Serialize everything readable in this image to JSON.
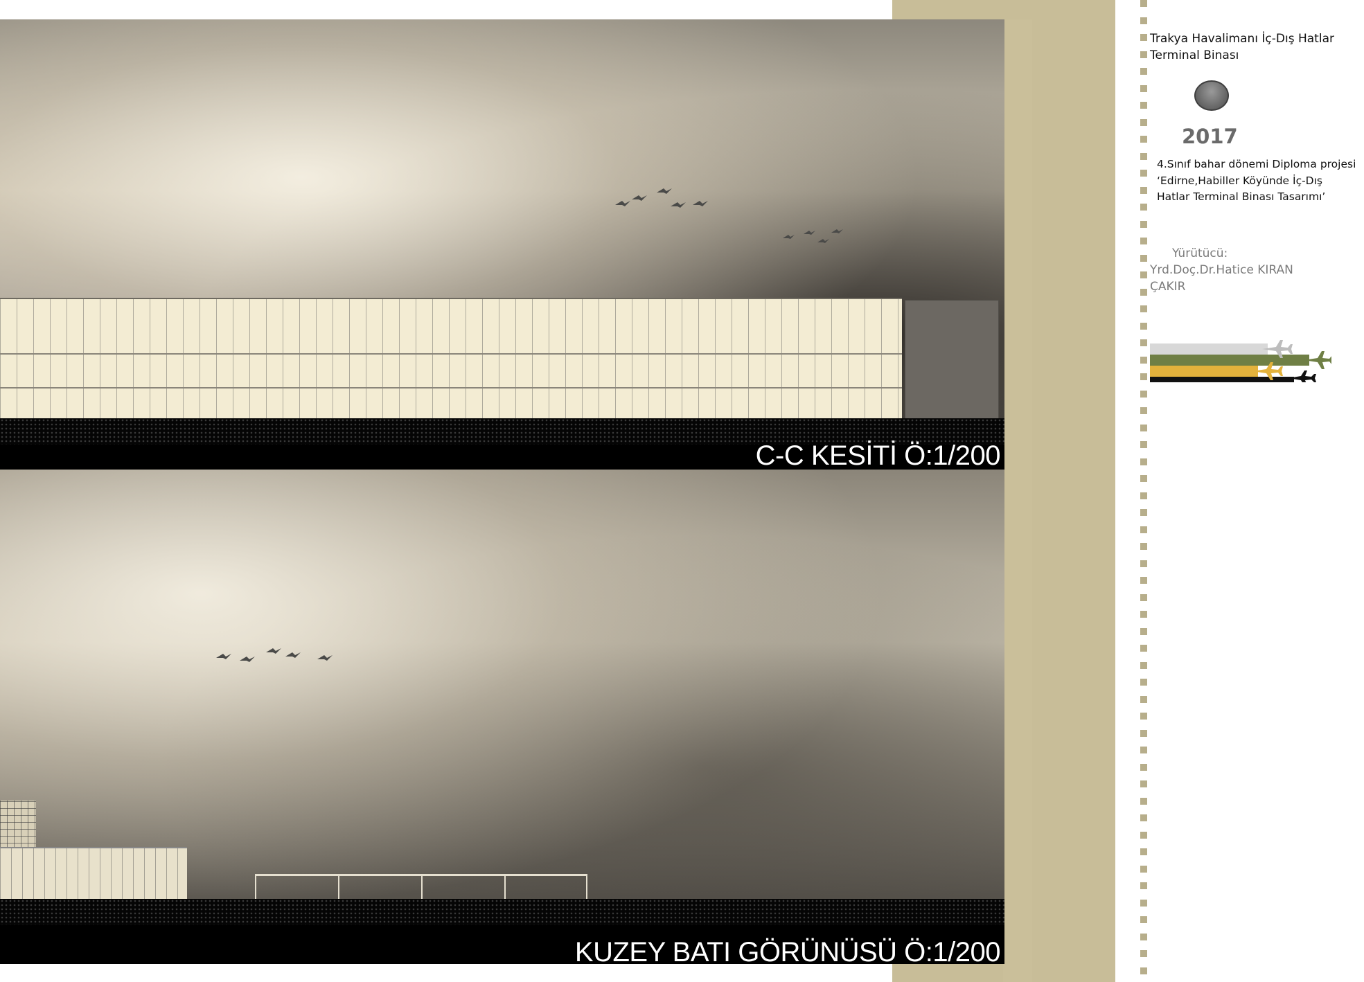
{
  "top_panel": {
    "caption": "C-C KESİTİ Ö:1/200"
  },
  "bottom_panel": {
    "caption": "KUZEY BATI GÖRÜNÜSÜ Ö:1/200"
  },
  "sidebar": {
    "title": "Trakya Havalimanı İç-Dış Hatlar Terminal Binası",
    "year": "2017",
    "description": "4.Sınıf bahar dönemi Diploma projesi ‘Edirne,Habiller Köyünde İç-Dış Hatlar Terminal Binası Tasarımı’",
    "advisor_label": "Yürütücü:",
    "advisor_name": "Yrd.Doç.Dr.Hatice KIRAN ÇAKIR"
  },
  "colors": {
    "tan_strip": "#c8bd98",
    "marker": "#b7ae8b",
    "green_band": "#6f7f45",
    "yellow_band": "#e3b23c",
    "black_band": "#111111",
    "gray_band": "#d8d8d8"
  }
}
